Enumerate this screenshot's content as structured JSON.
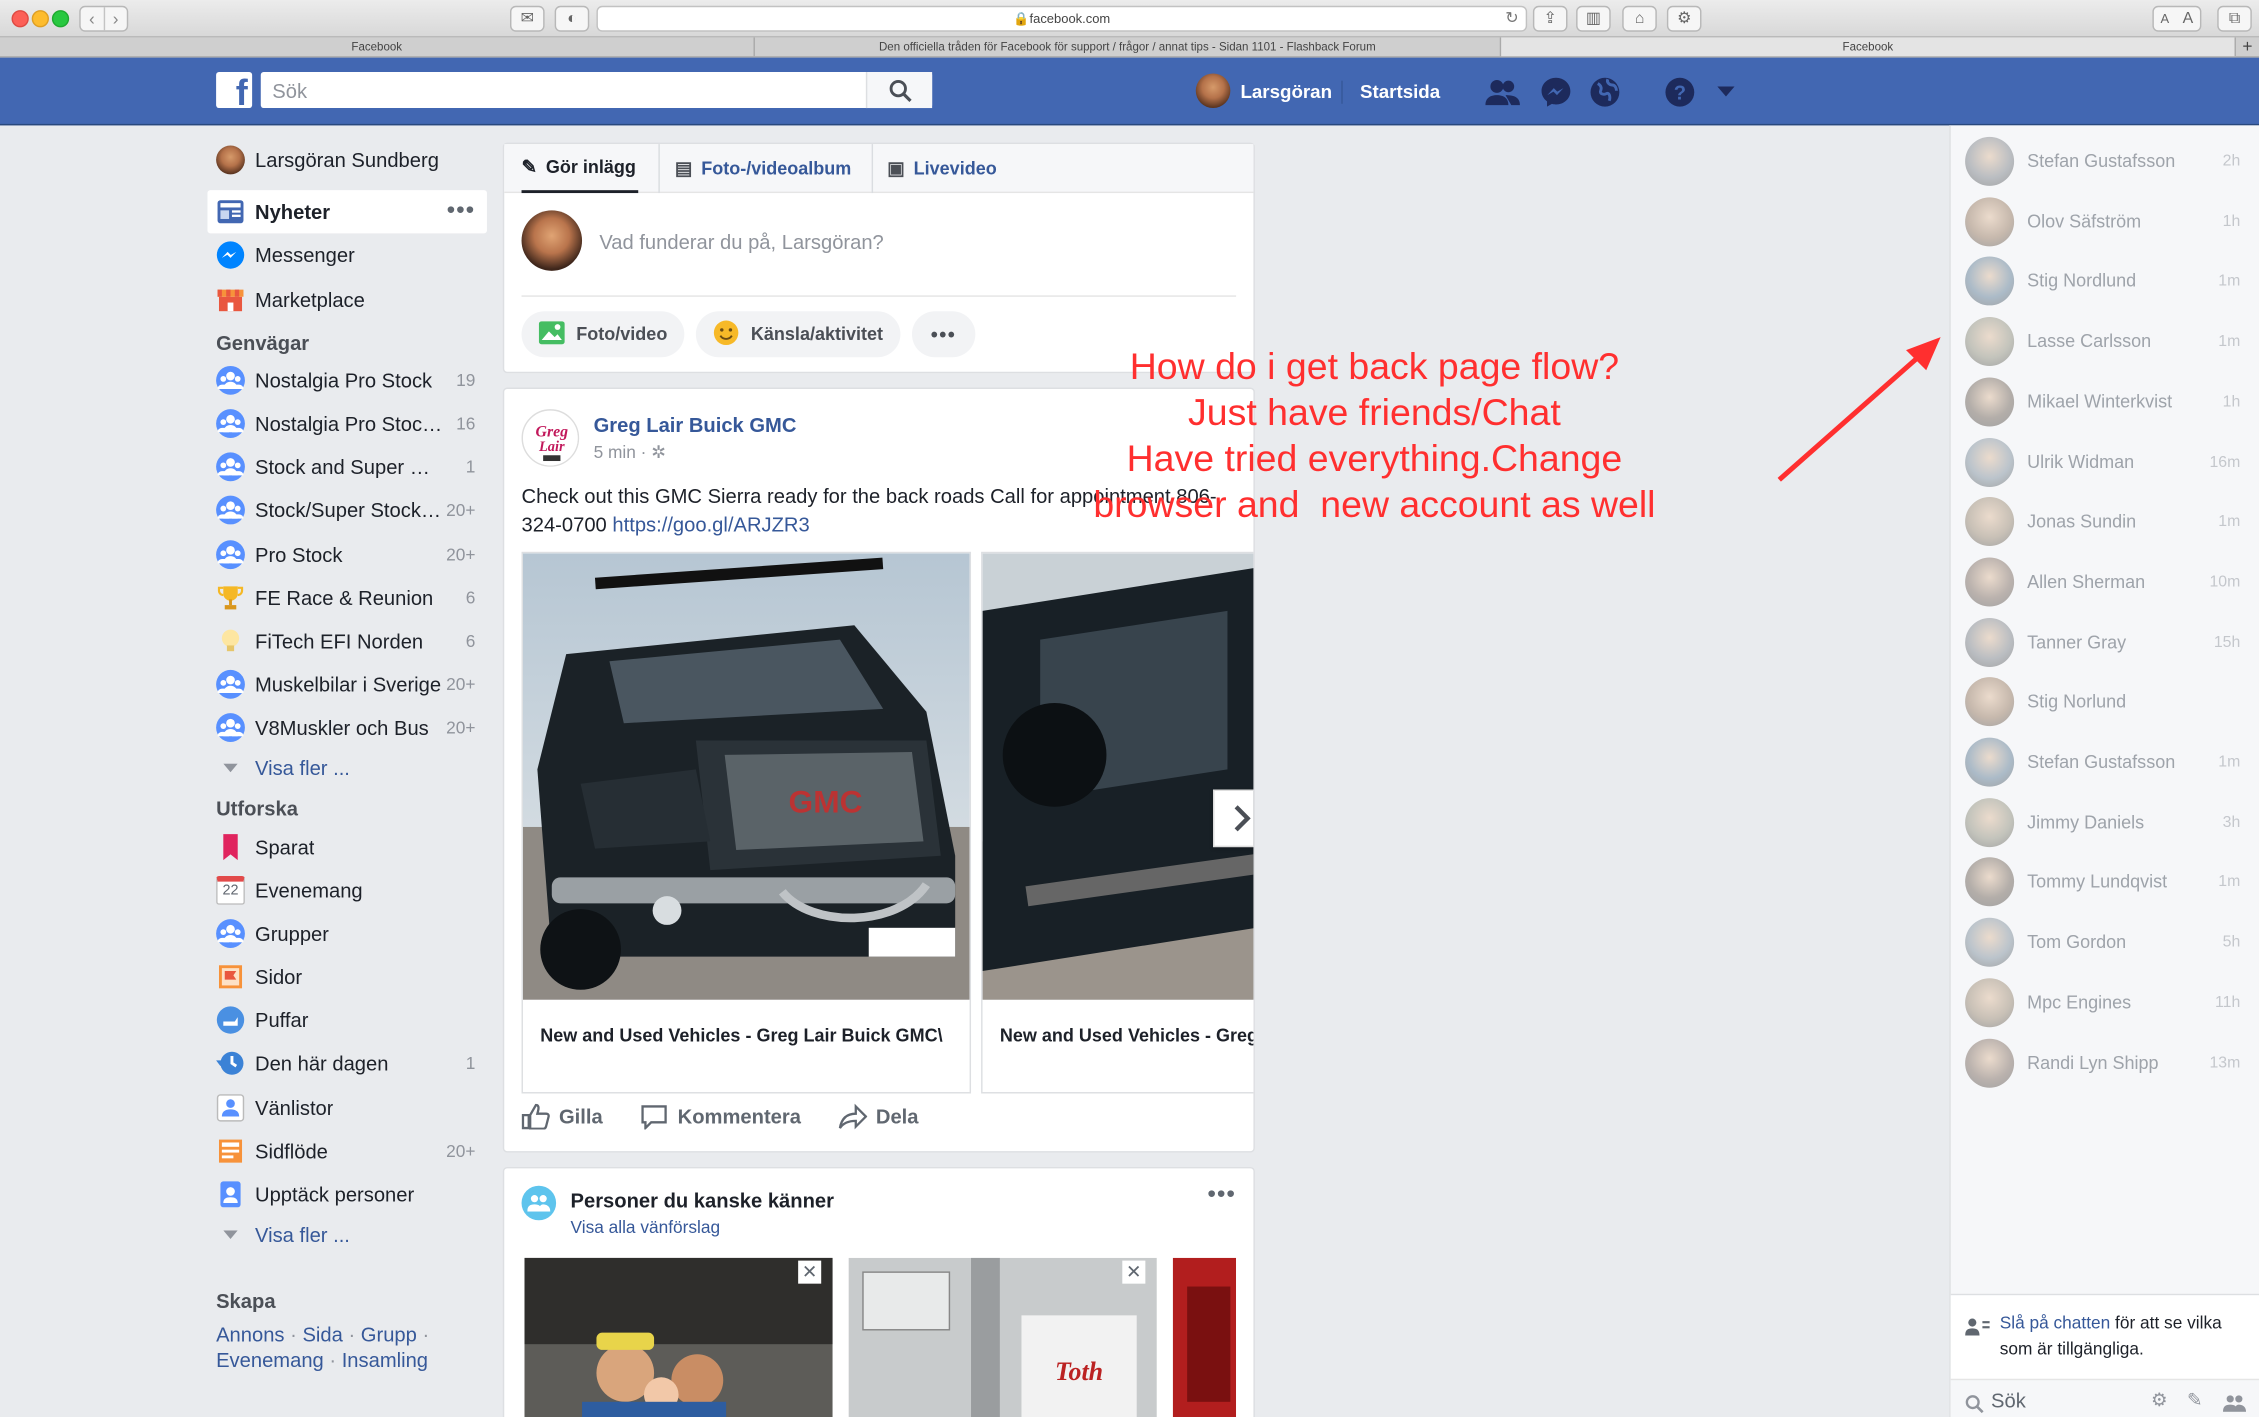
{
  "browser": {
    "url": "facebook.com",
    "tabs": [
      {
        "title": "Facebook"
      },
      {
        "title": "Den officiella tråden för Facebook för support / frågor / annat tips - Sidan 1101 - Flashback Forum"
      },
      {
        "title": "Facebook"
      }
    ],
    "text_size_small": "A",
    "text_size_large": "A"
  },
  "header": {
    "logo": "f",
    "search_placeholder": "Sök",
    "user_name": "Larsgöran",
    "home_label": "Startsida",
    "brand_color": "#4267b2"
  },
  "left_nav": {
    "profile_name": "Larsgöran Sundberg",
    "main": [
      {
        "label": "Nyheter",
        "icon": "news-feed-icon",
        "selected": true
      },
      {
        "label": "Messenger",
        "icon": "messenger-icon"
      },
      {
        "label": "Marketplace",
        "icon": "marketplace-icon"
      }
    ],
    "shortcuts_heading": "Genvägar",
    "shortcuts": [
      {
        "label": "Nostalgia Pro Stock",
        "count": "19",
        "icon": "group-icon"
      },
      {
        "label": "Nostalgia Pro Stock...",
        "count": "16",
        "icon": "group-icon"
      },
      {
        "label": "Stock and Super St...",
        "count": "1",
        "icon": "group-icon"
      },
      {
        "label": "Stock/Super Stock ...",
        "count": "20+",
        "icon": "group-icon"
      },
      {
        "label": "Pro Stock",
        "count": "20+",
        "icon": "group-icon"
      },
      {
        "label": "FE Race & Reunion",
        "count": "6",
        "icon": "trophy-icon"
      },
      {
        "label": "FiTech EFI Norden",
        "count": "6",
        "icon": "lightbulb-icon"
      },
      {
        "label": "Muskelbilar i Sverige",
        "count": "20+",
        "icon": "group-icon"
      },
      {
        "label": "V8Muskler och Bus",
        "count": "20+",
        "icon": "group-icon"
      }
    ],
    "shortcuts_more": "Visa fler ...",
    "explore_heading": "Utforska",
    "explore": [
      {
        "label": "Sparat",
        "count": "",
        "icon": "bookmark-icon"
      },
      {
        "label": "Evenemang",
        "count": "",
        "icon": "calendar-icon",
        "day": "22"
      },
      {
        "label": "Grupper",
        "count": "",
        "icon": "group-icon"
      },
      {
        "label": "Sidor",
        "count": "",
        "icon": "flag-icon"
      },
      {
        "label": "Puffar",
        "count": "",
        "icon": "poke-icon"
      },
      {
        "label": "Den här dagen",
        "count": "1",
        "icon": "memories-icon"
      },
      {
        "label": "Vänlistor",
        "count": "",
        "icon": "friend-list-icon"
      },
      {
        "label": "Sidflöde",
        "count": "20+",
        "icon": "pages-feed-icon"
      },
      {
        "label": "Upptäck personer",
        "count": "",
        "icon": "discover-people-icon"
      }
    ],
    "explore_more": "Visa fler ...",
    "create_heading": "Skapa",
    "create_links": [
      "Annons",
      "Sida",
      "Grupp",
      "Evenemang",
      "Insamling"
    ],
    "create_sep": " · "
  },
  "composer": {
    "tab_post": "Gör inlägg",
    "tab_album": "Foto-/videoalbum",
    "tab_live": "Livevideo",
    "placeholder": "Vad funderar du på, Larsgöran?",
    "photo_btn": "Foto/video",
    "feeling_btn": "Känsla/aktivitet"
  },
  "post": {
    "author": "Greg Lair Buick GMC",
    "time": "5 min · ",
    "text": "Check out this GMC Sierra ready for the back roads Call for appointment 806-324-0700 ",
    "link": "https://goo.gl/ARJZR3",
    "cards": [
      {
        "caption": "New and Used Vehicles - Greg Lair Buick GMC\\"
      },
      {
        "caption": "New and Used Vehicles - Greg Lair Buick GMC\\"
      }
    ],
    "like": "Gilla",
    "comment": "Kommentera",
    "share": "Dela"
  },
  "pymk": {
    "title": "Personer du kanske känner",
    "link": "Visa alla vänförslag"
  },
  "annotation": {
    "lines": [
      "How do i get back page flow?",
      "Just have friends/Chat",
      "Have tried everything.Change",
      "browser and  new account as well"
    ],
    "color": "#ff2f2f"
  },
  "chat": {
    "contacts": [
      {
        "name": "Stefan Gustafsson",
        "time": "2h"
      },
      {
        "name": "Olov Säfström",
        "time": "1h"
      },
      {
        "name": "Stig Nordlund",
        "time": "1m"
      },
      {
        "name": "Lasse Carlsson",
        "time": "1m"
      },
      {
        "name": "Mikael Winterkvist",
        "time": "1h"
      },
      {
        "name": "Ulrik Widman",
        "time": "16m"
      },
      {
        "name": "Jonas Sundin",
        "time": "1m"
      },
      {
        "name": "Allen Sherman",
        "time": "10m"
      },
      {
        "name": "Tanner Gray",
        "time": "15h"
      },
      {
        "name": "Stig Norlund",
        "time": ""
      },
      {
        "name": "Stefan Gustafsson",
        "time": "1m"
      },
      {
        "name": "Jimmy Daniels",
        "time": "3h"
      },
      {
        "name": "Tommy Lundqvist",
        "time": "1m"
      },
      {
        "name": "Tom Gordon",
        "time": "5h"
      },
      {
        "name": "Mpc Engines",
        "time": "11h"
      },
      {
        "name": "Randi Lyn Shipp",
        "time": "13m"
      }
    ],
    "turn_on_link": "Slå på chatten",
    "turn_on_rest": " för att se vilka som är tillgängliga.",
    "search_placeholder": "Sök"
  }
}
